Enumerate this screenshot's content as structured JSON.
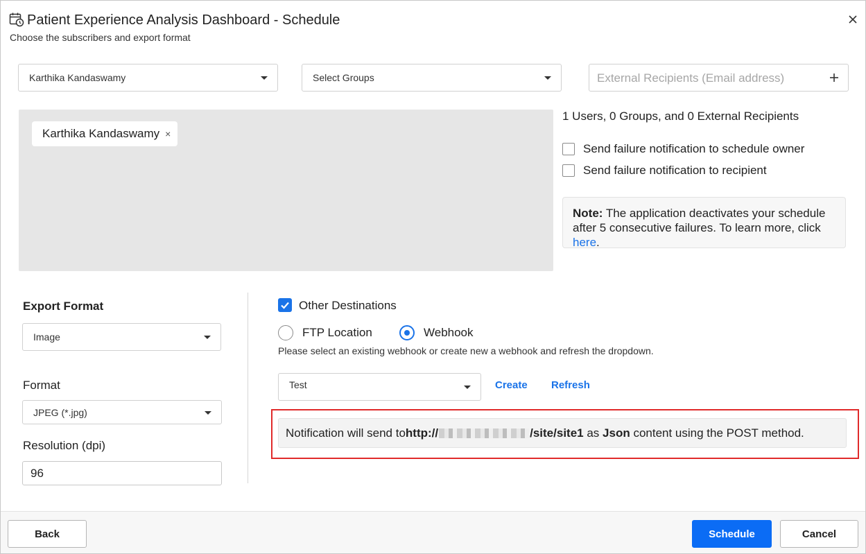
{
  "header": {
    "title": "Patient Experience Analysis Dashboard - Schedule",
    "subtitle": "Choose the subscribers and export format",
    "icon": "calendar-clock-icon",
    "close_icon": "close-icon"
  },
  "recipients": {
    "users_select": "Karthika Kandaswamy",
    "groups_select": "Select Groups",
    "external_placeholder": "External Recipients (Email address)",
    "chips": [
      {
        "label": "Karthika Kandaswamy",
        "remove": "×"
      }
    ],
    "summary": "1 Users, 0 Groups, and 0 External Recipients"
  },
  "notifications": {
    "owner_label": "Send failure notification to schedule owner",
    "owner_checked": false,
    "recipient_label": "Send failure notification to recipient",
    "recipient_checked": false
  },
  "note": {
    "bold": "Note:",
    "text": " The application deactivates your schedule after 5 consecutive failures. To learn more, click ",
    "link": "here",
    "end": "."
  },
  "export": {
    "export_format_label": "Export Format",
    "export_format_value": "Image",
    "format_label": "Format",
    "format_value": "JPEG (*.jpg)",
    "resolution_label": "Resolution (dpi)",
    "resolution_value": "96"
  },
  "destinations": {
    "other_label": "Other Destinations",
    "other_checked": true,
    "ftp_label": "FTP Location",
    "webhook_label": "Webhook",
    "selected": "webhook",
    "hint": "Please select an existing webhook or create new a webhook and refresh the dropdown.",
    "webhook_value": "Test",
    "create_label": "Create",
    "refresh_label": "Refresh"
  },
  "notification_message": {
    "prefix": "Notification will send to ",
    "url_start": "http://",
    "url_end": "/site/site1",
    "middle": " as ",
    "content_type": "Json",
    "suffix": " content using the POST method."
  },
  "footer": {
    "back_label": "Back",
    "schedule_label": "Schedule",
    "cancel_label": "Cancel"
  },
  "colors": {
    "accent": "#1a73e8",
    "primary_button": "#0b6cf5",
    "highlight_border": "#e02a2a"
  }
}
